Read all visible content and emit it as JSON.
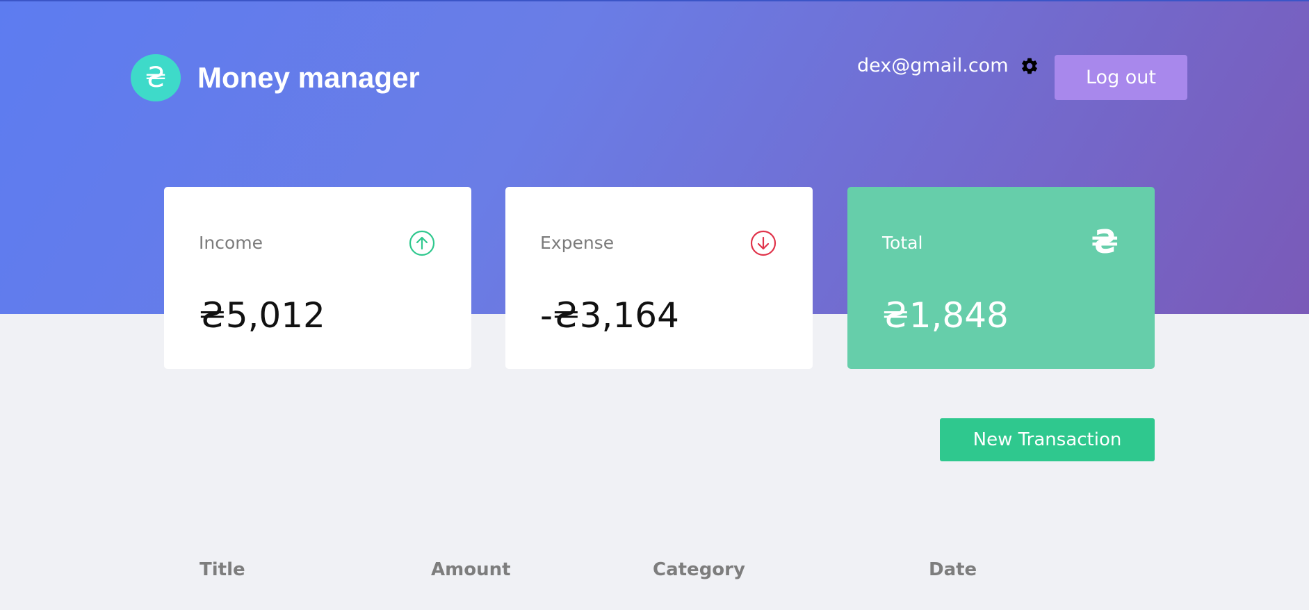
{
  "brand": {
    "logo_symbol": "₴",
    "title": "Money manager"
  },
  "header": {
    "email": "dex@gmail.com",
    "settings_icon": "gear-icon",
    "logout_label": "Log out"
  },
  "summary": {
    "income": {
      "label": "Income",
      "value": "₴5,012",
      "icon": "arrow-up-circle-icon",
      "icon_color": "#2fc88e"
    },
    "expense": {
      "label": "Expense",
      "value": "-₴3,164",
      "icon": "arrow-down-circle-icon",
      "icon_color": "#e0334a"
    },
    "total": {
      "label": "Total",
      "value": "₴1,848",
      "icon_symbol": "₴",
      "card_color": "#66ceaa"
    }
  },
  "actions": {
    "new_transaction_label": "New Transaction"
  },
  "table": {
    "headers": [
      "Title",
      "Amount",
      "Category",
      "Date"
    ]
  },
  "colors": {
    "accent_green": "#2fc88e",
    "logo_teal": "#3edac9",
    "logout_purple": "#a888ec"
  }
}
